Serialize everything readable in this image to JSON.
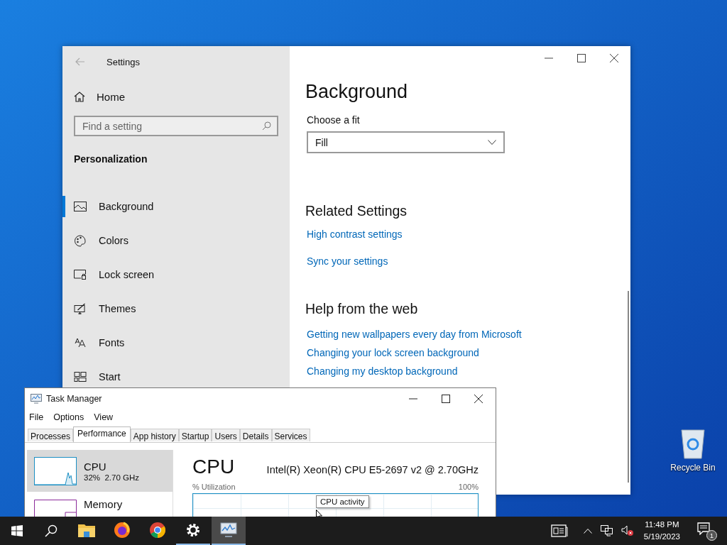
{
  "settings_window": {
    "title": "Settings",
    "home": "Home",
    "search": {
      "placeholder": "Find a setting"
    },
    "section": "Personalization",
    "nav_items": [
      {
        "label": "Background",
        "kind": "picture",
        "selected": true
      },
      {
        "label": "Colors",
        "kind": "palette",
        "selected": false
      },
      {
        "label": "Lock screen",
        "kind": "lock",
        "selected": false
      },
      {
        "label": "Themes",
        "kind": "brush",
        "selected": false
      },
      {
        "label": "Fonts",
        "kind": "fonts",
        "selected": false
      },
      {
        "label": "Start",
        "kind": "start",
        "selected": false
      }
    ],
    "page_title": "Background",
    "fit_label": "Choose a fit",
    "fit_value": "Fill",
    "related_title": "Related Settings",
    "related_links": [
      "High contrast settings",
      "Sync your settings"
    ],
    "help_title": "Help from the web",
    "help_links": [
      "Getting new wallpapers every day from Microsoft",
      "Changing your lock screen background",
      "Changing my desktop background"
    ]
  },
  "desktop_icons": [
    {
      "label": "Recycle Bin"
    }
  ],
  "task_manager": {
    "title": "Task Manager",
    "menu": [
      "File",
      "Options",
      "View"
    ],
    "tabs": [
      {
        "label": "Processes",
        "selected": false
      },
      {
        "label": "Performance",
        "selected": true
      },
      {
        "label": "App history",
        "selected": false
      },
      {
        "label": "Startup",
        "selected": false
      },
      {
        "label": "Users",
        "selected": false
      },
      {
        "label": "Details",
        "selected": false
      },
      {
        "label": "Services",
        "selected": false
      }
    ],
    "resources": [
      {
        "name": "CPU",
        "detail": "32%  2.70 GHz",
        "kind": "cpu",
        "selected": true
      },
      {
        "name": "Memory",
        "kind": "memory",
        "selected": false
      }
    ],
    "heading": "CPU",
    "model": "Intel(R) Xeon(R) CPU E5-2697 v2 @ 2.70GHz",
    "graph_label": "% Utilization",
    "graph_max": "100%",
    "tooltip": "CPU activity"
  },
  "taskbar": {
    "apps": [
      {
        "kind": "explorer",
        "running": false,
        "selected": false
      },
      {
        "kind": "firefox",
        "running": false,
        "selected": false
      },
      {
        "kind": "chrome",
        "running": false,
        "selected": false
      },
      {
        "kind": "settings",
        "running": true,
        "selected": false
      },
      {
        "kind": "taskmgr",
        "running": true,
        "selected": true
      }
    ],
    "time": "11:48 PM",
    "date": "5/19/2023",
    "notifications": "1"
  }
}
